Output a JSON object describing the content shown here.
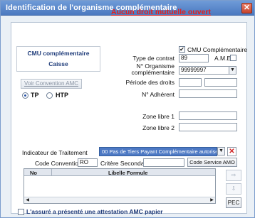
{
  "window": {
    "title": "Identification de l'organisme complémentaire",
    "close": "✕"
  },
  "status_title": "Aucun droit mutuelle ouvert",
  "left_box": {
    "line1": "CMU complémentaire",
    "line2": "Caisse"
  },
  "cmu_checkbox_label": "CMU Complémentaire",
  "fields": {
    "type_contrat_label": "Type de contrat",
    "type_contrat_value": "89",
    "ame_label": "A.M.E",
    "organisme_label_1": "N° Organisme",
    "organisme_label_2": "complémentaire",
    "organisme_value": "99999997",
    "periode_label": "Période des droits",
    "adherent_label": "N° Adhérent",
    "zone1_label": "Zone libre 1",
    "zone2_label": "Zone libre 2"
  },
  "voir_convention": "Voir Convention AMC",
  "radios": {
    "tp": "TP",
    "htp": "HTP"
  },
  "indicateur": {
    "label": "Indicateur de Traitement",
    "value": "00  Pas de Tiers Payant Complémentaire autorisé"
  },
  "convention": {
    "code_label": "Code Convention",
    "code_value": "RO",
    "critere_label": "Critère Secondaire",
    "service_button": "Code Service AMO"
  },
  "grid": {
    "col_no": "No",
    "col_libelle": "Libelle Formule"
  },
  "pec_button": "PEC",
  "bottom_checkbox": "L'assuré a présenté une attestation AMC papier"
}
